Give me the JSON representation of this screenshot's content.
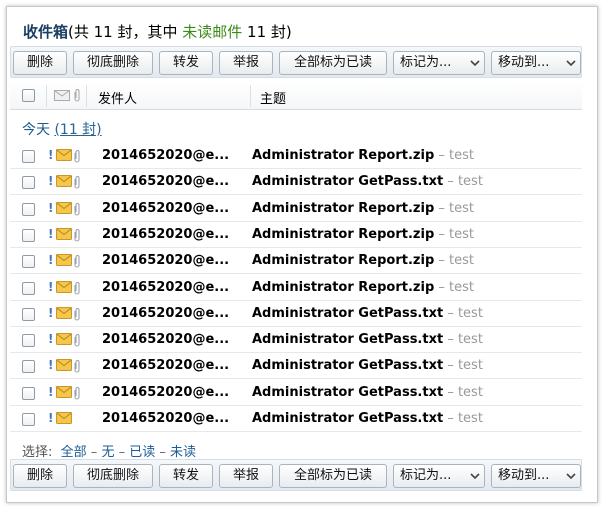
{
  "title": {
    "folder": "收件箱",
    "count_prefix": "(共 11 封，其中 ",
    "unread_link": "未读邮件",
    "count_suffix": " 11 封)"
  },
  "toolbar": {
    "delete": "删除",
    "delete_permanently": "彻底删除",
    "forward": "转发",
    "report": "举报",
    "mark_all_read": "全部标为已读",
    "mark_as": "标记为...",
    "move_to": "移动到..."
  },
  "columns": {
    "sender": "发件人",
    "subject": "主题"
  },
  "group": {
    "label": "今天",
    "count": "(11 封)"
  },
  "emails": [
    {
      "sender": "2014652020@e...",
      "subject": "Administrator Report.zip",
      "preview": " – test",
      "attachment": true
    },
    {
      "sender": "2014652020@e...",
      "subject": "Administrator GetPass.txt",
      "preview": " – test",
      "attachment": true
    },
    {
      "sender": "2014652020@e...",
      "subject": "Administrator Report.zip",
      "preview": " – test",
      "attachment": true
    },
    {
      "sender": "2014652020@e...",
      "subject": "Administrator Report.zip",
      "preview": " – test",
      "attachment": true
    },
    {
      "sender": "2014652020@e...",
      "subject": "Administrator Report.zip",
      "preview": " – test",
      "attachment": true
    },
    {
      "sender": "2014652020@e...",
      "subject": "Administrator Report.zip",
      "preview": " – test",
      "attachment": true
    },
    {
      "sender": "2014652020@e...",
      "subject": "Administrator GetPass.txt",
      "preview": " – test",
      "attachment": true
    },
    {
      "sender": "2014652020@e...",
      "subject": "Administrator GetPass.txt",
      "preview": " – test",
      "attachment": true
    },
    {
      "sender": "2014652020@e...",
      "subject": "Administrator GetPass.txt",
      "preview": " – test",
      "attachment": true
    },
    {
      "sender": "2014652020@e...",
      "subject": "Administrator GetPass.txt",
      "preview": " – test",
      "attachment": true
    },
    {
      "sender": "2014652020@e...",
      "subject": "Administrator GetPass.txt",
      "preview": " – test",
      "attachment": false
    }
  ],
  "selectbar": {
    "label": "选择:",
    "all": "全部",
    "none": "无",
    "read": "已读",
    "unread": "未读",
    "dash": " – "
  },
  "colors": {
    "title": "#1b3f63",
    "unread_link": "#3c8a17",
    "link": "#1e5d96",
    "envelope": "#f2c23c"
  }
}
